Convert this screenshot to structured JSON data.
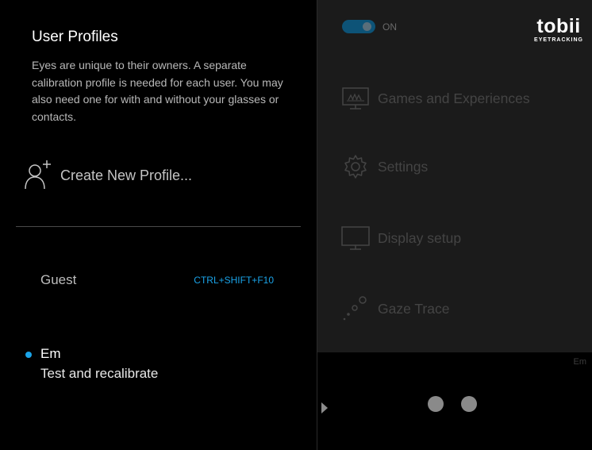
{
  "left": {
    "title": "User Profiles",
    "description": "Eyes are unique to their owners. A separate calibration profile is needed for each user. You may also need one for with and without your glasses or contacts.",
    "create_label": "Create New Profile...",
    "profiles": [
      {
        "name": "Guest",
        "shortcut": "CTRL+SHIFT+F10",
        "active": false
      },
      {
        "name": "Em",
        "action": "Test and recalibrate",
        "active": true
      }
    ]
  },
  "right": {
    "toggle_label": "ON",
    "toggle_on": true,
    "brand_name": "tobii",
    "brand_sub": "EYETRACKING",
    "nav": [
      {
        "label": "Games and Experiences",
        "icon": "games-monitor-icon"
      },
      {
        "label": "Settings",
        "icon": "gear-icon"
      },
      {
        "label": "Display setup",
        "icon": "monitor-icon"
      },
      {
        "label": "Gaze Trace",
        "icon": "gaze-trace-icon"
      }
    ],
    "current_user": "Em"
  },
  "colors": {
    "accent": "#1aa3e8",
    "panel_bg": "#1b1b1b",
    "background": "#000000"
  }
}
